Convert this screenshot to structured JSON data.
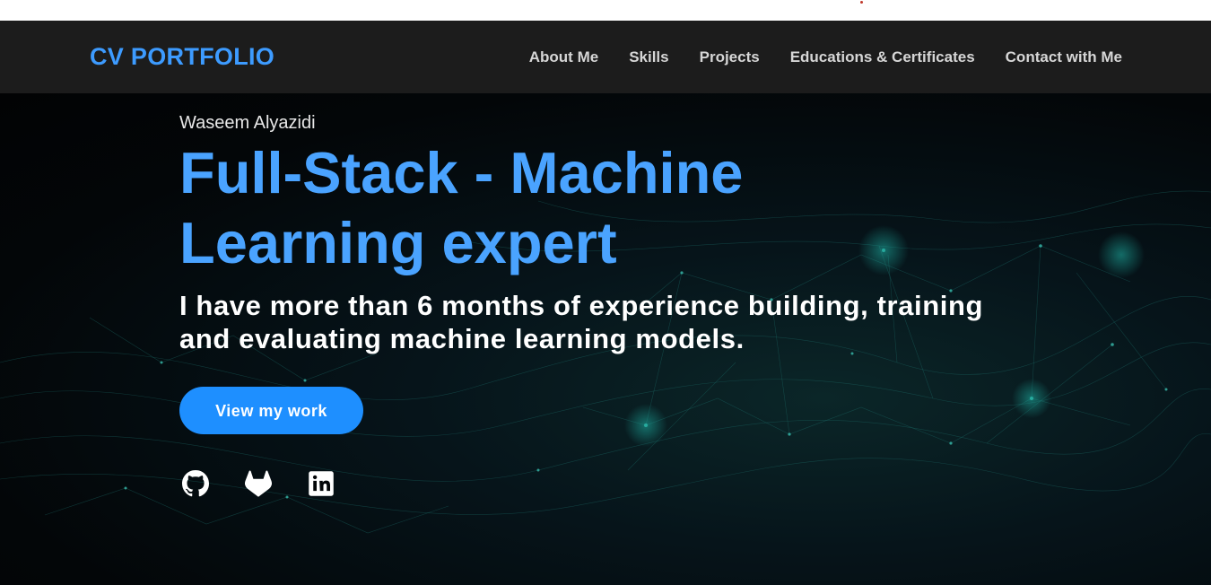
{
  "nav": {
    "brand": "CV PORTFOLIO",
    "links": [
      {
        "label": "About Me"
      },
      {
        "label": "Skills"
      },
      {
        "label": "Projects"
      },
      {
        "label": "Educations & Certificates"
      },
      {
        "label": "Contact with Me"
      }
    ]
  },
  "hero": {
    "name": "Waseem Alyazidi",
    "headline": "Full-Stack - Machine Learning expert",
    "tagline": "I have more than 6 months of experience building, training and evaluating machine learning models.",
    "cta_label": "View my work"
  },
  "socials": [
    {
      "icon": "github-icon"
    },
    {
      "icon": "gitlab-icon"
    },
    {
      "icon": "linkedin-icon"
    }
  ],
  "colors": {
    "accent": "#4aa3ff",
    "button": "#1e8fff",
    "navbar": "#1c1c1c",
    "hero_bg": "#030608"
  }
}
